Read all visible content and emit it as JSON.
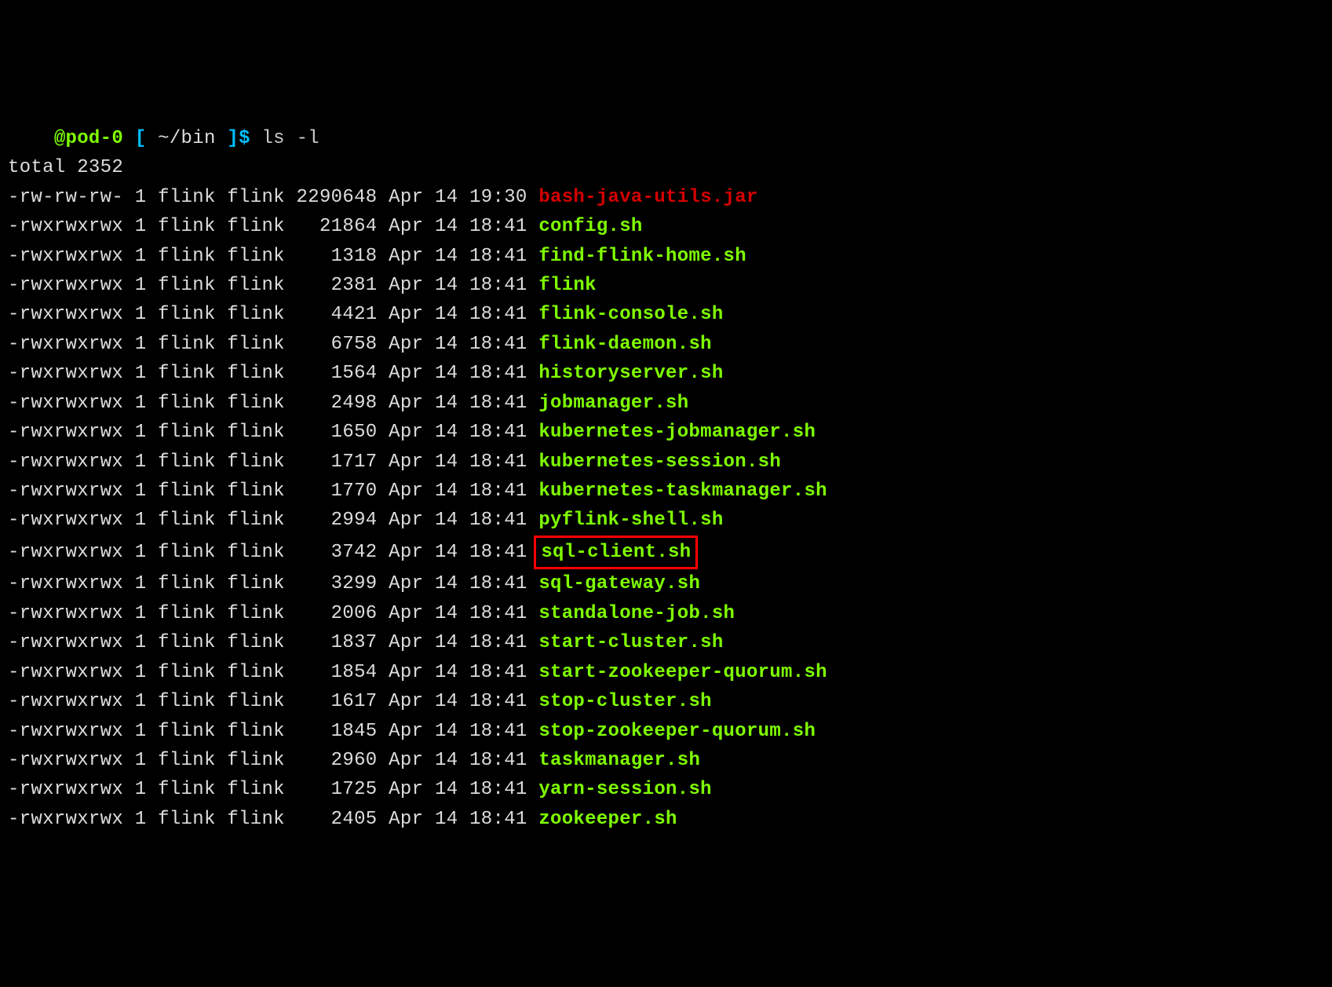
{
  "prompt": {
    "host": "@pod-0",
    "lbracket": " [ ",
    "path": "~/bin",
    "rbracket": " ]",
    "dollar": "$ ",
    "command": "ls -l"
  },
  "total_line": "total 2352",
  "rows": [
    {
      "perms": "-rw-rw-rw-",
      "links": "1",
      "owner": "flink",
      "group": "flink",
      "size": "2290648",
      "month": "Apr",
      "day": "14",
      "time": "19:30",
      "name": "bash-java-utils.jar",
      "kind": "regular",
      "highlight": false
    },
    {
      "perms": "-rwxrwxrwx",
      "links": "1",
      "owner": "flink",
      "group": "flink",
      "size": "21864",
      "month": "Apr",
      "day": "14",
      "time": "18:41",
      "name": "config.sh",
      "kind": "exec",
      "highlight": false
    },
    {
      "perms": "-rwxrwxrwx",
      "links": "1",
      "owner": "flink",
      "group": "flink",
      "size": "1318",
      "month": "Apr",
      "day": "14",
      "time": "18:41",
      "name": "find-flink-home.sh",
      "kind": "exec",
      "highlight": false
    },
    {
      "perms": "-rwxrwxrwx",
      "links": "1",
      "owner": "flink",
      "group": "flink",
      "size": "2381",
      "month": "Apr",
      "day": "14",
      "time": "18:41",
      "name": "flink",
      "kind": "exec",
      "highlight": false
    },
    {
      "perms": "-rwxrwxrwx",
      "links": "1",
      "owner": "flink",
      "group": "flink",
      "size": "4421",
      "month": "Apr",
      "day": "14",
      "time": "18:41",
      "name": "flink-console.sh",
      "kind": "exec",
      "highlight": false
    },
    {
      "perms": "-rwxrwxrwx",
      "links": "1",
      "owner": "flink",
      "group": "flink",
      "size": "6758",
      "month": "Apr",
      "day": "14",
      "time": "18:41",
      "name": "flink-daemon.sh",
      "kind": "exec",
      "highlight": false
    },
    {
      "perms": "-rwxrwxrwx",
      "links": "1",
      "owner": "flink",
      "group": "flink",
      "size": "1564",
      "month": "Apr",
      "day": "14",
      "time": "18:41",
      "name": "historyserver.sh",
      "kind": "exec",
      "highlight": false
    },
    {
      "perms": "-rwxrwxrwx",
      "links": "1",
      "owner": "flink",
      "group": "flink",
      "size": "2498",
      "month": "Apr",
      "day": "14",
      "time": "18:41",
      "name": "jobmanager.sh",
      "kind": "exec",
      "highlight": false
    },
    {
      "perms": "-rwxrwxrwx",
      "links": "1",
      "owner": "flink",
      "group": "flink",
      "size": "1650",
      "month": "Apr",
      "day": "14",
      "time": "18:41",
      "name": "kubernetes-jobmanager.sh",
      "kind": "exec",
      "highlight": false
    },
    {
      "perms": "-rwxrwxrwx",
      "links": "1",
      "owner": "flink",
      "group": "flink",
      "size": "1717",
      "month": "Apr",
      "day": "14",
      "time": "18:41",
      "name": "kubernetes-session.sh",
      "kind": "exec",
      "highlight": false
    },
    {
      "perms": "-rwxrwxrwx",
      "links": "1",
      "owner": "flink",
      "group": "flink",
      "size": "1770",
      "month": "Apr",
      "day": "14",
      "time": "18:41",
      "name": "kubernetes-taskmanager.sh",
      "kind": "exec",
      "highlight": false
    },
    {
      "perms": "-rwxrwxrwx",
      "links": "1",
      "owner": "flink",
      "group": "flink",
      "size": "2994",
      "month": "Apr",
      "day": "14",
      "time": "18:41",
      "name": "pyflink-shell.sh",
      "kind": "exec",
      "highlight": false
    },
    {
      "perms": "-rwxrwxrwx",
      "links": "1",
      "owner": "flink",
      "group": "flink",
      "size": "3742",
      "month": "Apr",
      "day": "14",
      "time": "18:41",
      "name": "sql-client.sh",
      "kind": "exec",
      "highlight": true
    },
    {
      "perms": "-rwxrwxrwx",
      "links": "1",
      "owner": "flink",
      "group": "flink",
      "size": "3299",
      "month": "Apr",
      "day": "14",
      "time": "18:41",
      "name": "sql-gateway.sh",
      "kind": "exec",
      "highlight": false
    },
    {
      "perms": "-rwxrwxrwx",
      "links": "1",
      "owner": "flink",
      "group": "flink",
      "size": "2006",
      "month": "Apr",
      "day": "14",
      "time": "18:41",
      "name": "standalone-job.sh",
      "kind": "exec",
      "highlight": false
    },
    {
      "perms": "-rwxrwxrwx",
      "links": "1",
      "owner": "flink",
      "group": "flink",
      "size": "1837",
      "month": "Apr",
      "day": "14",
      "time": "18:41",
      "name": "start-cluster.sh",
      "kind": "exec",
      "highlight": false
    },
    {
      "perms": "-rwxrwxrwx",
      "links": "1",
      "owner": "flink",
      "group": "flink",
      "size": "1854",
      "month": "Apr",
      "day": "14",
      "time": "18:41",
      "name": "start-zookeeper-quorum.sh",
      "kind": "exec",
      "highlight": false
    },
    {
      "perms": "-rwxrwxrwx",
      "links": "1",
      "owner": "flink",
      "group": "flink",
      "size": "1617",
      "month": "Apr",
      "day": "14",
      "time": "18:41",
      "name": "stop-cluster.sh",
      "kind": "exec",
      "highlight": false
    },
    {
      "perms": "-rwxrwxrwx",
      "links": "1",
      "owner": "flink",
      "group": "flink",
      "size": "1845",
      "month": "Apr",
      "day": "14",
      "time": "18:41",
      "name": "stop-zookeeper-quorum.sh",
      "kind": "exec",
      "highlight": false
    },
    {
      "perms": "-rwxrwxrwx",
      "links": "1",
      "owner": "flink",
      "group": "flink",
      "size": "2960",
      "month": "Apr",
      "day": "14",
      "time": "18:41",
      "name": "taskmanager.sh",
      "kind": "exec",
      "highlight": false
    },
    {
      "perms": "-rwxrwxrwx",
      "links": "1",
      "owner": "flink",
      "group": "flink",
      "size": "1725",
      "month": "Apr",
      "day": "14",
      "time": "18:41",
      "name": "yarn-session.sh",
      "kind": "exec",
      "highlight": false
    },
    {
      "perms": "-rwxrwxrwx",
      "links": "1",
      "owner": "flink",
      "group": "flink",
      "size": "2405",
      "month": "Apr",
      "day": "14",
      "time": "18:41",
      "name": "zookeeper.sh",
      "kind": "exec",
      "highlight": false
    }
  ]
}
